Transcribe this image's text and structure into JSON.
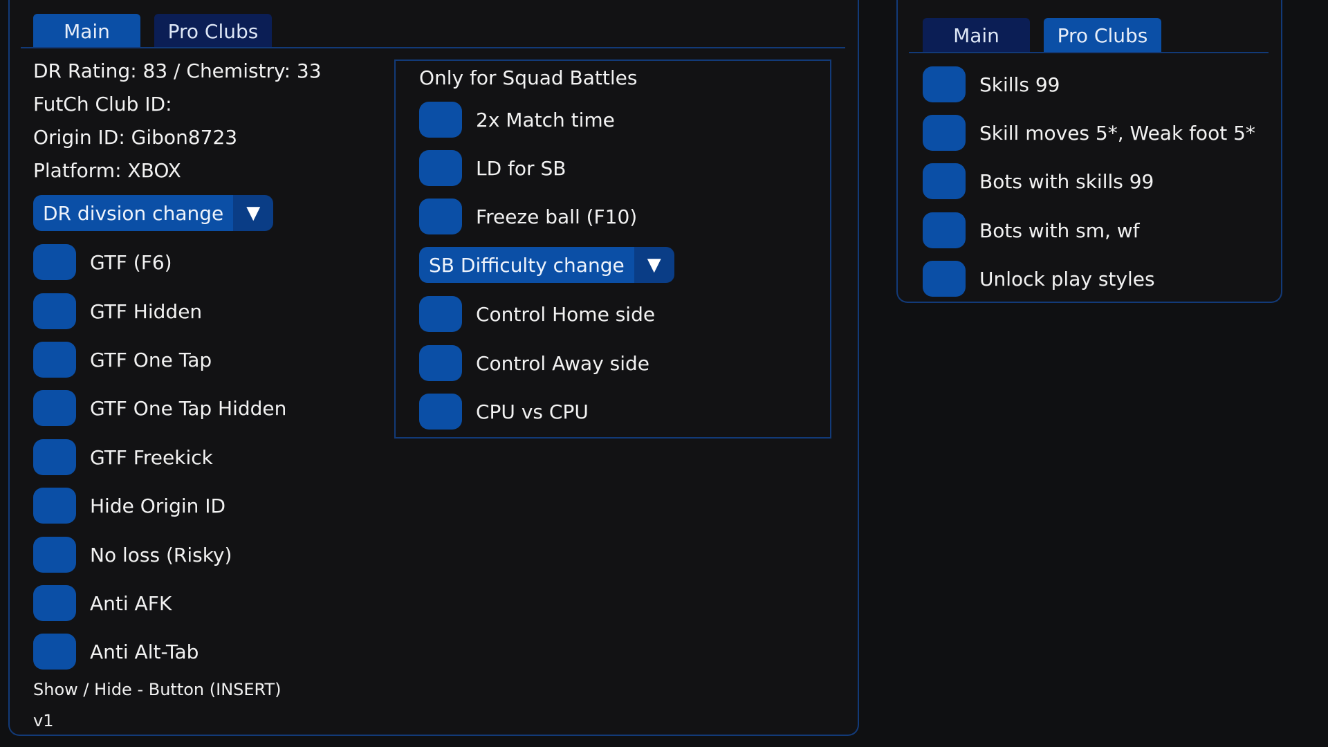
{
  "left_panel": {
    "tabs": [
      {
        "label": "Main",
        "active": true
      },
      {
        "label": "Pro Clubs",
        "active": false
      }
    ],
    "info": {
      "dr_rating": "DR Rating: 83 / Chemistry: 33",
      "club_id": "FutCh Club ID:",
      "origin_id": "Origin ID: Gibon8723",
      "platform": "Platform: XBOX"
    },
    "dr_dropdown": "DR divsion change",
    "toggles": [
      "GTF (F6)",
      "GTF Hidden",
      "GTF One Tap",
      "GTF One Tap Hidden",
      "GTF Freekick",
      "Hide Origin ID",
      "No loss (Risky)",
      "Anti AFK",
      "Anti Alt-Tab"
    ],
    "squad_battles": {
      "title": "Only for Squad Battles",
      "toggles_top": [
        "2x Match time",
        "LD for SB",
        "Freeze ball (F10)"
      ],
      "dropdown": "SB Difficulty change",
      "toggles_bottom": [
        "Control Home side",
        "Control Away side",
        "CPU vs CPU"
      ]
    },
    "footer": {
      "hint": "Show / Hide - Button (INSERT)",
      "version": "v1"
    }
  },
  "right_panel": {
    "tabs": [
      {
        "label": "Main",
        "active": false
      },
      {
        "label": "Pro Clubs",
        "active": true
      }
    ],
    "toggles": [
      "Skills 99",
      "Skill moves 5*, Weak foot 5*",
      "Bots with skills 99",
      "Bots with sm, wf",
      "Unlock play styles"
    ]
  },
  "icons": {
    "dropdown_arrow": "▼"
  },
  "colors": {
    "background": "#0f1012",
    "accent": "#0b4fa6",
    "accent_dark": "#0b1e55",
    "border": "#123a78"
  }
}
